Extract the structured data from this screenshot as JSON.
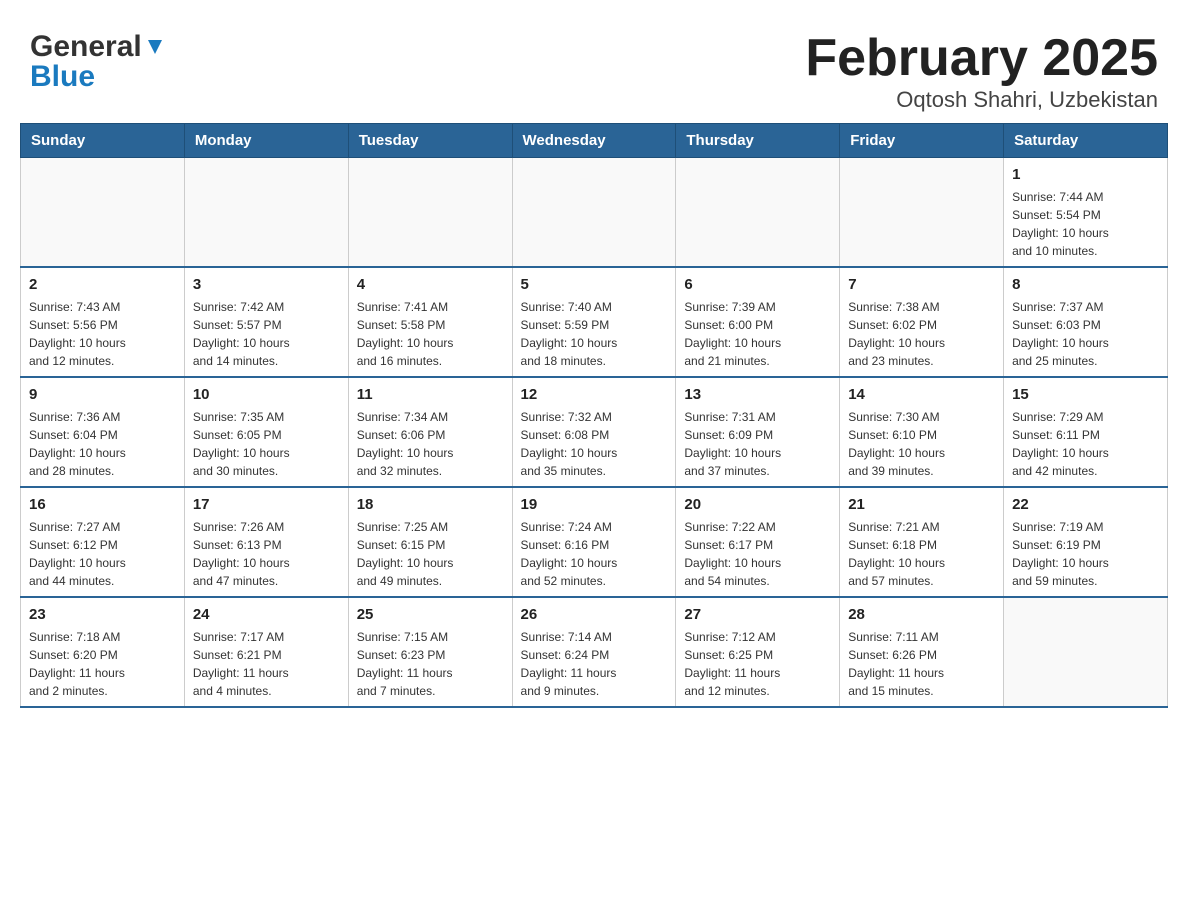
{
  "header": {
    "title": "February 2025",
    "subtitle": "Oqtosh Shahri, Uzbekistan",
    "logo_general": "General",
    "logo_blue": "Blue"
  },
  "weekdays": [
    "Sunday",
    "Monday",
    "Tuesday",
    "Wednesday",
    "Thursday",
    "Friday",
    "Saturday"
  ],
  "weeks": [
    [
      {
        "day": "",
        "info": ""
      },
      {
        "day": "",
        "info": ""
      },
      {
        "day": "",
        "info": ""
      },
      {
        "day": "",
        "info": ""
      },
      {
        "day": "",
        "info": ""
      },
      {
        "day": "",
        "info": ""
      },
      {
        "day": "1",
        "info": "Sunrise: 7:44 AM\nSunset: 5:54 PM\nDaylight: 10 hours\nand 10 minutes."
      }
    ],
    [
      {
        "day": "2",
        "info": "Sunrise: 7:43 AM\nSunset: 5:56 PM\nDaylight: 10 hours\nand 12 minutes."
      },
      {
        "day": "3",
        "info": "Sunrise: 7:42 AM\nSunset: 5:57 PM\nDaylight: 10 hours\nand 14 minutes."
      },
      {
        "day": "4",
        "info": "Sunrise: 7:41 AM\nSunset: 5:58 PM\nDaylight: 10 hours\nand 16 minutes."
      },
      {
        "day": "5",
        "info": "Sunrise: 7:40 AM\nSunset: 5:59 PM\nDaylight: 10 hours\nand 18 minutes."
      },
      {
        "day": "6",
        "info": "Sunrise: 7:39 AM\nSunset: 6:00 PM\nDaylight: 10 hours\nand 21 minutes."
      },
      {
        "day": "7",
        "info": "Sunrise: 7:38 AM\nSunset: 6:02 PM\nDaylight: 10 hours\nand 23 minutes."
      },
      {
        "day": "8",
        "info": "Sunrise: 7:37 AM\nSunset: 6:03 PM\nDaylight: 10 hours\nand 25 minutes."
      }
    ],
    [
      {
        "day": "9",
        "info": "Sunrise: 7:36 AM\nSunset: 6:04 PM\nDaylight: 10 hours\nand 28 minutes."
      },
      {
        "day": "10",
        "info": "Sunrise: 7:35 AM\nSunset: 6:05 PM\nDaylight: 10 hours\nand 30 minutes."
      },
      {
        "day": "11",
        "info": "Sunrise: 7:34 AM\nSunset: 6:06 PM\nDaylight: 10 hours\nand 32 minutes."
      },
      {
        "day": "12",
        "info": "Sunrise: 7:32 AM\nSunset: 6:08 PM\nDaylight: 10 hours\nand 35 minutes."
      },
      {
        "day": "13",
        "info": "Sunrise: 7:31 AM\nSunset: 6:09 PM\nDaylight: 10 hours\nand 37 minutes."
      },
      {
        "day": "14",
        "info": "Sunrise: 7:30 AM\nSunset: 6:10 PM\nDaylight: 10 hours\nand 39 minutes."
      },
      {
        "day": "15",
        "info": "Sunrise: 7:29 AM\nSunset: 6:11 PM\nDaylight: 10 hours\nand 42 minutes."
      }
    ],
    [
      {
        "day": "16",
        "info": "Sunrise: 7:27 AM\nSunset: 6:12 PM\nDaylight: 10 hours\nand 44 minutes."
      },
      {
        "day": "17",
        "info": "Sunrise: 7:26 AM\nSunset: 6:13 PM\nDaylight: 10 hours\nand 47 minutes."
      },
      {
        "day": "18",
        "info": "Sunrise: 7:25 AM\nSunset: 6:15 PM\nDaylight: 10 hours\nand 49 minutes."
      },
      {
        "day": "19",
        "info": "Sunrise: 7:24 AM\nSunset: 6:16 PM\nDaylight: 10 hours\nand 52 minutes."
      },
      {
        "day": "20",
        "info": "Sunrise: 7:22 AM\nSunset: 6:17 PM\nDaylight: 10 hours\nand 54 minutes."
      },
      {
        "day": "21",
        "info": "Sunrise: 7:21 AM\nSunset: 6:18 PM\nDaylight: 10 hours\nand 57 minutes."
      },
      {
        "day": "22",
        "info": "Sunrise: 7:19 AM\nSunset: 6:19 PM\nDaylight: 10 hours\nand 59 minutes."
      }
    ],
    [
      {
        "day": "23",
        "info": "Sunrise: 7:18 AM\nSunset: 6:20 PM\nDaylight: 11 hours\nand 2 minutes."
      },
      {
        "day": "24",
        "info": "Sunrise: 7:17 AM\nSunset: 6:21 PM\nDaylight: 11 hours\nand 4 minutes."
      },
      {
        "day": "25",
        "info": "Sunrise: 7:15 AM\nSunset: 6:23 PM\nDaylight: 11 hours\nand 7 minutes."
      },
      {
        "day": "26",
        "info": "Sunrise: 7:14 AM\nSunset: 6:24 PM\nDaylight: 11 hours\nand 9 minutes."
      },
      {
        "day": "27",
        "info": "Sunrise: 7:12 AM\nSunset: 6:25 PM\nDaylight: 11 hours\nand 12 minutes."
      },
      {
        "day": "28",
        "info": "Sunrise: 7:11 AM\nSunset: 6:26 PM\nDaylight: 11 hours\nand 15 minutes."
      },
      {
        "day": "",
        "info": ""
      }
    ]
  ]
}
